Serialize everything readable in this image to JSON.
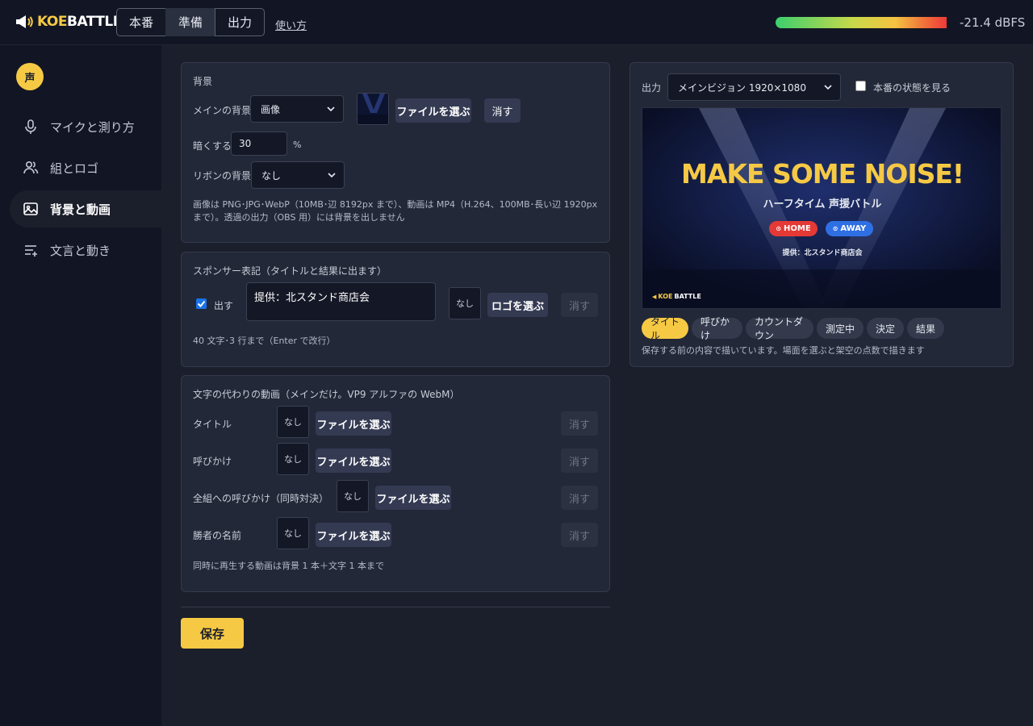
{
  "app": {
    "logo_text_a": "KOE",
    "logo_text_b": "BATTLE",
    "mode_tabs": [
      {
        "label": "本番"
      },
      {
        "label": "準備"
      },
      {
        "label": "出力"
      }
    ],
    "active_mode": "準備",
    "help_link": "使い方",
    "level_meter": {
      "value_text": "-21.4 dBFS",
      "fill_fraction": 1.0
    },
    "colors": {
      "accent": "#f6c945",
      "background": "#1b1f2b",
      "panel": "#232838",
      "sidebar": "#121624"
    }
  },
  "sidebar": {
    "avatar": "声",
    "items": [
      {
        "label": "マイクと測り方",
        "icon": "microphone-icon"
      },
      {
        "label": "組とロゴ",
        "icon": "users-icon"
      },
      {
        "label": "背景と動画",
        "icon": "image-icon"
      },
      {
        "label": "文言と動き",
        "icon": "text-lines-icon"
      }
    ],
    "active_item": "背景と動画"
  },
  "background_panel": {
    "title": "背景",
    "main_bg_label": "メインの背景",
    "main_bg_value": "画像",
    "choose_file": "ファイルを選ぶ",
    "clear": "消す",
    "darken_label": "暗くする",
    "darken_value": "30",
    "darken_unit": "%",
    "ribbon_label": "リボンの背景",
    "ribbon_value": "なし",
    "note": "画像は PNG･JPG･WebP（10MB･辺 8192px まで）、動画は MP4（H.264、100MB･長い辺 1920px まで）。透過の出力（OBS 用）には背景を出しません"
  },
  "sponsor_panel": {
    "title": "スポンサー表記（タイトルと結果に出ます）",
    "show_label": "出す",
    "show_checked": true,
    "text_value": "提供：北スタンド商店会",
    "logo_none": "なし",
    "choose_logo": "ロゴを選ぶ",
    "clear": "消す",
    "note": "40 文字･3 行まで（Enter で改行）"
  },
  "video_panel": {
    "title": "文字の代わりの動画（メインだけ。VP9 アルファの WebM）",
    "rows": [
      {
        "label": "タイトル",
        "none": "なし",
        "choose": "ファイルを選ぶ",
        "clear": "消す"
      },
      {
        "label": "呼びかけ",
        "none": "なし",
        "choose": "ファイルを選ぶ",
        "clear": "消す"
      },
      {
        "label": "全組への呼びかけ（同時対決）",
        "none": "なし",
        "choose": "ファイルを選ぶ",
        "clear": "消す"
      },
      {
        "label": "勝者の名前",
        "none": "なし",
        "choose": "ファイルを選ぶ",
        "clear": "消す"
      }
    ],
    "note": "同時に再生する動画は背景 1 本＋文字 1 本まで"
  },
  "save_label": "保存",
  "output_panel": {
    "output_label": "出力",
    "output_value": "メインビジョン 1920×1080",
    "live_label": "本番の状態を見る",
    "live_checked": false,
    "preview": {
      "headline": "MAKE SOME NOISE!",
      "subtitle": "ハーフタイム 声援バトル",
      "home": "HOME",
      "away": "AWAY",
      "sponsor": "提供：北スタンド商店会",
      "logo_a": "KOE",
      "logo_b": "BATTLE"
    },
    "scene_chips": [
      {
        "label": "タイトル"
      },
      {
        "label": "呼びかけ"
      },
      {
        "label": "カウントダウン"
      },
      {
        "label": "測定中"
      },
      {
        "label": "決定"
      },
      {
        "label": "結果"
      }
    ],
    "active_chip": "タイトル",
    "note": "保存する前の内容で描いています。場面を選ぶと架空の点数で描きます"
  }
}
